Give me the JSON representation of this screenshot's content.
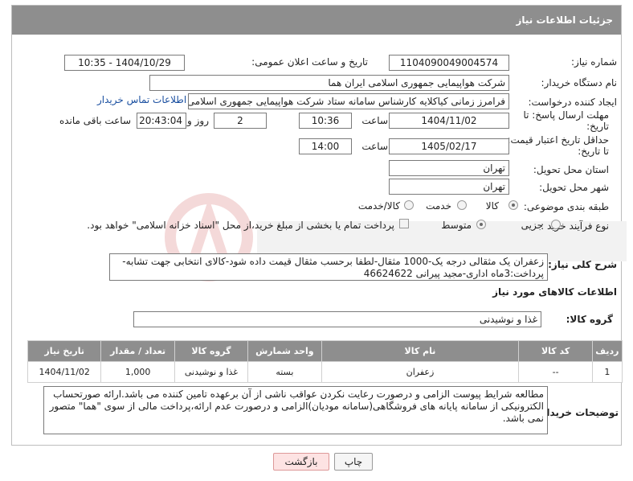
{
  "header": {
    "title": "جزئیات اطلاعات نیاز"
  },
  "fields": {
    "need_number_label": "شماره نیاز:",
    "need_number": "1104090049004574",
    "announce_label": "تاریخ و ساعت اعلان عمومی:",
    "announce_value": "1404/10/29 - 10:35",
    "buyer_label": "نام دستگاه خریدار:",
    "buyer_value": "شرکت هواپیمایی جمهوری اسلامی ایران هما",
    "creator_label": "ایجاد کننده درخواست:",
    "creator_value": "فرامرز زمانی کیاکلایه کارشناس سامانه ستاد شرکت هواپیمایی جمهوری اسلامی ایران هما",
    "contact_link": "اطلاعات تماس خریدار",
    "deadline_label_1": "مهلت ارسال پاسخ: تا",
    "deadline_label_2": "تاریخ:",
    "deadline_date": "1404/11/02",
    "time_word": "ساعت",
    "deadline_time": "10:36",
    "days_value": "2",
    "days_word": "روز و",
    "remaining_time": "20:43:04",
    "remaining_word": "ساعت باقی مانده",
    "min_price_label_1": "حداقل تاریخ اعتبار قیمت:",
    "min_price_label_2": "تا تاریخ:",
    "validity_date": "1405/02/17",
    "validity_time": "14:00",
    "province_label": "استان محل تحویل:",
    "province_value": "تهران",
    "city_label": "شهر محل تحویل:",
    "city_value": "تهران",
    "category_label": "طبقه بندی موضوعی:",
    "category_options": [
      "کالا",
      "خدمت",
      "کالا/خدمت"
    ],
    "process_label": "نوع فرآیند خرید :",
    "process_options": [
      "جزیی",
      "متوسط"
    ],
    "payment_note": "پرداخت تمام یا بخشی از مبلغ خرید،از محل \"اسناد خزانه اسلامی\" خواهد بود."
  },
  "description": {
    "label": "شرح کلی نیاز:",
    "text": "زعفران یک مثقالی درجه یک-1000 مثقال-لطفا برحسب مثقال قیمت داده شود-کالای انتخابی جهت تشابه-پرداخت:3ماه اداری-مجید پیرانی 46624622"
  },
  "goods_section": {
    "title": "اطلاعات کالاهای مورد نیاز",
    "group_label": "گروه کالا:",
    "group_value": "غذا و نوشیدنی"
  },
  "table": {
    "headers": [
      "ردیف",
      "کد کالا",
      "نام کالا",
      "واحد شمارش",
      "گروه کالا",
      "تعداد / مقدار",
      "تاریخ نیاز"
    ],
    "rows": [
      [
        "1",
        "--",
        "زعفران",
        "بسته",
        "غذا و نوشیدنی",
        "1,000",
        "1404/11/02"
      ]
    ]
  },
  "buyer_notes": {
    "label": "توضیحات خریدار:",
    "text": "مطالعه شرایط پیوست الزامی و درصورت رعایت نکردن عواقب ناشی از آن برعهده تامین کننده می باشد.ارائه صورتحساب الکترونیکی از سامانه پایانه های فروشگاهی(سامانه مودیان)الزامی و درصورت عدم ارائه،پرداخت مالی از سوی \"هما\" متصور نمی باشد."
  },
  "buttons": {
    "print": "چاپ",
    "back": "بازگشت"
  },
  "colors": {
    "header_bg": "#8e8e8e",
    "link": "#1a4fa0",
    "back_bg": "#fde3e3"
  }
}
